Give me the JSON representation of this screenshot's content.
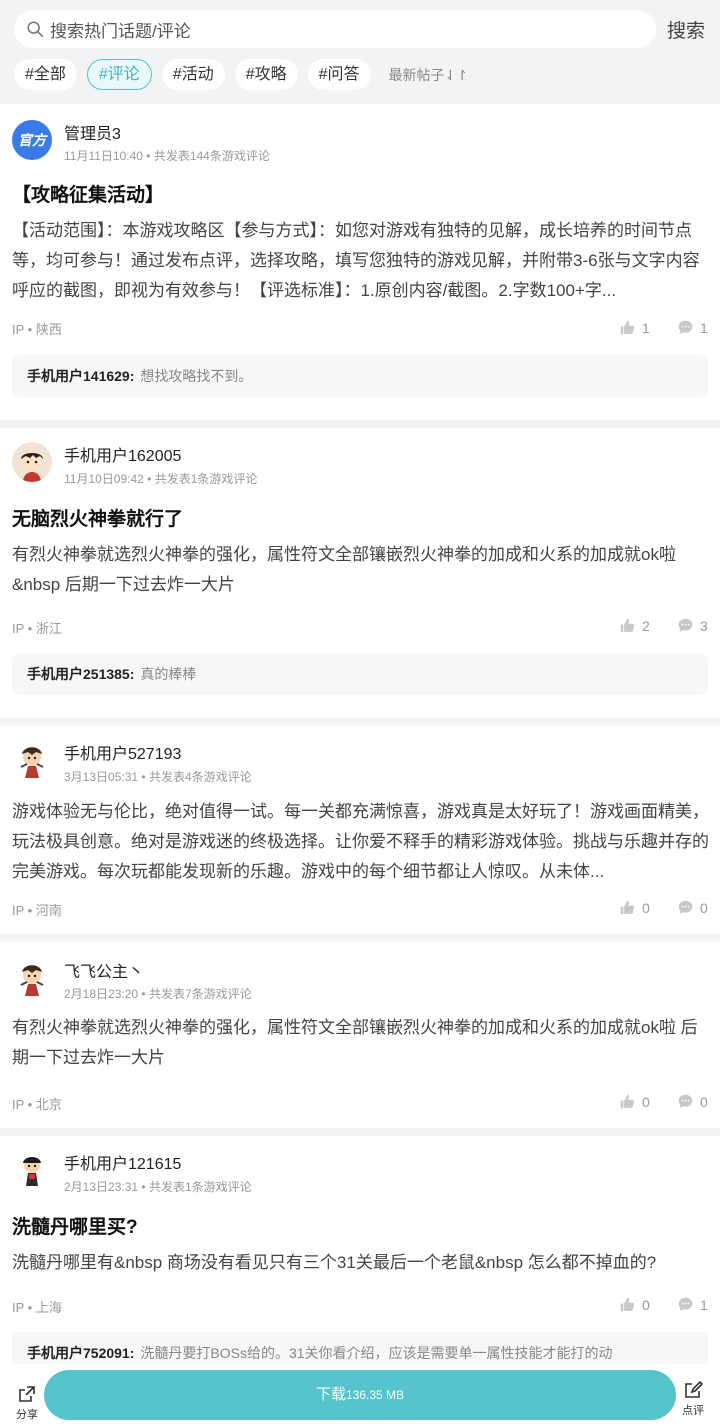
{
  "search": {
    "placeholder": "搜索热门话题/评论",
    "button": "搜索"
  },
  "tabs": [
    "#全部",
    "#评论",
    "#活动",
    "#攻略",
    "#问答"
  ],
  "active_tab": "#评论",
  "sort_label": "最新帖子⇃↾",
  "posts": [
    {
      "avatar_text": "官方",
      "user": "管理员3",
      "time": "11月11日10:40",
      "count": "共发表144条游戏评论",
      "title": "【攻略征集活动】",
      "body": "【活动范围】：本游戏攻略区【参与方式】：如您对游戏有独特的见解，成长培养的时间节点等，均可参与！通过发布点评，选择攻略，填写您独特的游戏见解，并附带3-6张与文字内容呼应的截图，即视为有效参与！【评选标准】：1.原创内容/截图。2.字数100+字...",
      "ip": "IP • 陕西",
      "likes": "1",
      "comments": "1",
      "reply_user": "手机用户141629:",
      "reply_text": "想找攻略找不到。"
    },
    {
      "user": "手机用户162005",
      "time": "11月10日09:42",
      "count": "共发表1条游戏评论",
      "title": "无脑烈火神拳就行了",
      "body": "有烈火神拳就选烈火神拳的强化，属性符文全部镶嵌烈火神拳的加成和火系的加成就ok啦&nbsp 后期一下过去炸一大片",
      "ip": "IP • 浙江",
      "likes": "2",
      "comments": "3",
      "reply_user": "手机用户251385:",
      "reply_text": "真的棒棒"
    },
    {
      "user": "手机用户527193",
      "time": "3月13日05:31",
      "count": "共发表4条游戏评论",
      "body": "游戏体验无与伦比，绝对值得一试。每一关都充满惊喜，游戏真是太好玩了！游戏画面精美，玩法极具创意。绝对是游戏迷的终极选择。让你爱不释手的精彩游戏体验。挑战与乐趣并存的完美游戏。每次玩都能发现新的乐趣。游戏中的每个细节都让人惊叹。从未体...",
      "ip": "IP • 河南",
      "likes": "0",
      "comments": "0"
    },
    {
      "user": "飞飞公主丶",
      "time": "2月18日23:20",
      "count": "共发表7条游戏评论",
      "body": "有烈火神拳就选烈火神拳的强化，属性符文全部镶嵌烈火神拳的加成和火系的加成就ok啦 后期一下过去炸一大片",
      "ip": "IP • 北京",
      "likes": "0",
      "comments": "0"
    },
    {
      "user": "手机用户121615",
      "time": "2月13日23:31",
      "count": "共发表1条游戏评论",
      "title": "洗髓丹哪里买?",
      "body": "洗髓丹哪里有&nbsp 商场没有看见只有三个31关最后一个老鼠&nbsp 怎么都不掉血的?",
      "ip": "IP • 上海",
      "likes": "0",
      "comments": "1",
      "reply_user": "手机用户752091:",
      "reply_text": "洗髓丹要打BOSs给的。31关你看介绍，应该是需要单一属性技能才能打的动"
    }
  ],
  "bottom": {
    "share": "分享",
    "download": "下载",
    "size": "136.35 MB",
    "review": "点评"
  },
  "colors": {
    "accent": "#55c4cb",
    "official_avatar": "#3a7be8"
  }
}
